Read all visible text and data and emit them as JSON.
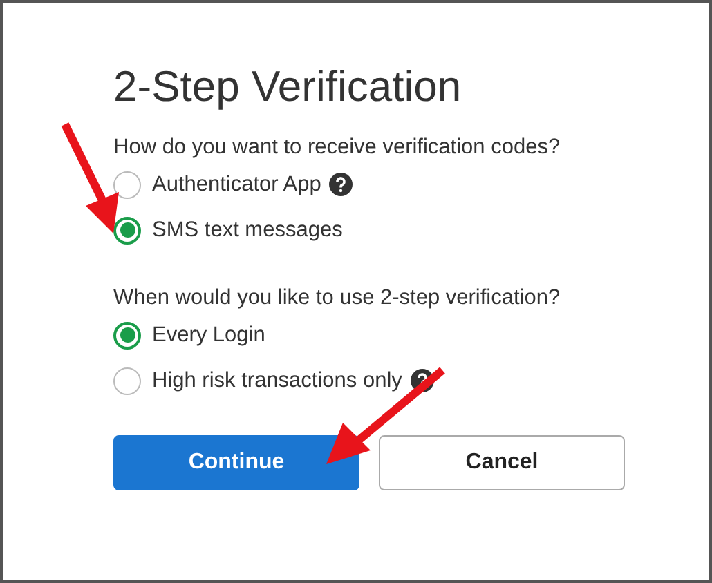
{
  "title": "2-Step Verification",
  "groups": [
    {
      "question": "How do you want to receive verification codes?",
      "options": [
        {
          "label": "Authenticator App",
          "selected": false,
          "help": true
        },
        {
          "label": "SMS text messages",
          "selected": true,
          "help": false
        }
      ]
    },
    {
      "question": "When would you like to use 2-step verification?",
      "options": [
        {
          "label": "Every Login",
          "selected": true,
          "help": false
        },
        {
          "label": "High risk transactions only",
          "selected": false,
          "help": true
        }
      ]
    }
  ],
  "buttons": [
    {
      "label": "Continue",
      "kind": "primary"
    },
    {
      "label": "Cancel",
      "kind": "secondary"
    }
  ]
}
